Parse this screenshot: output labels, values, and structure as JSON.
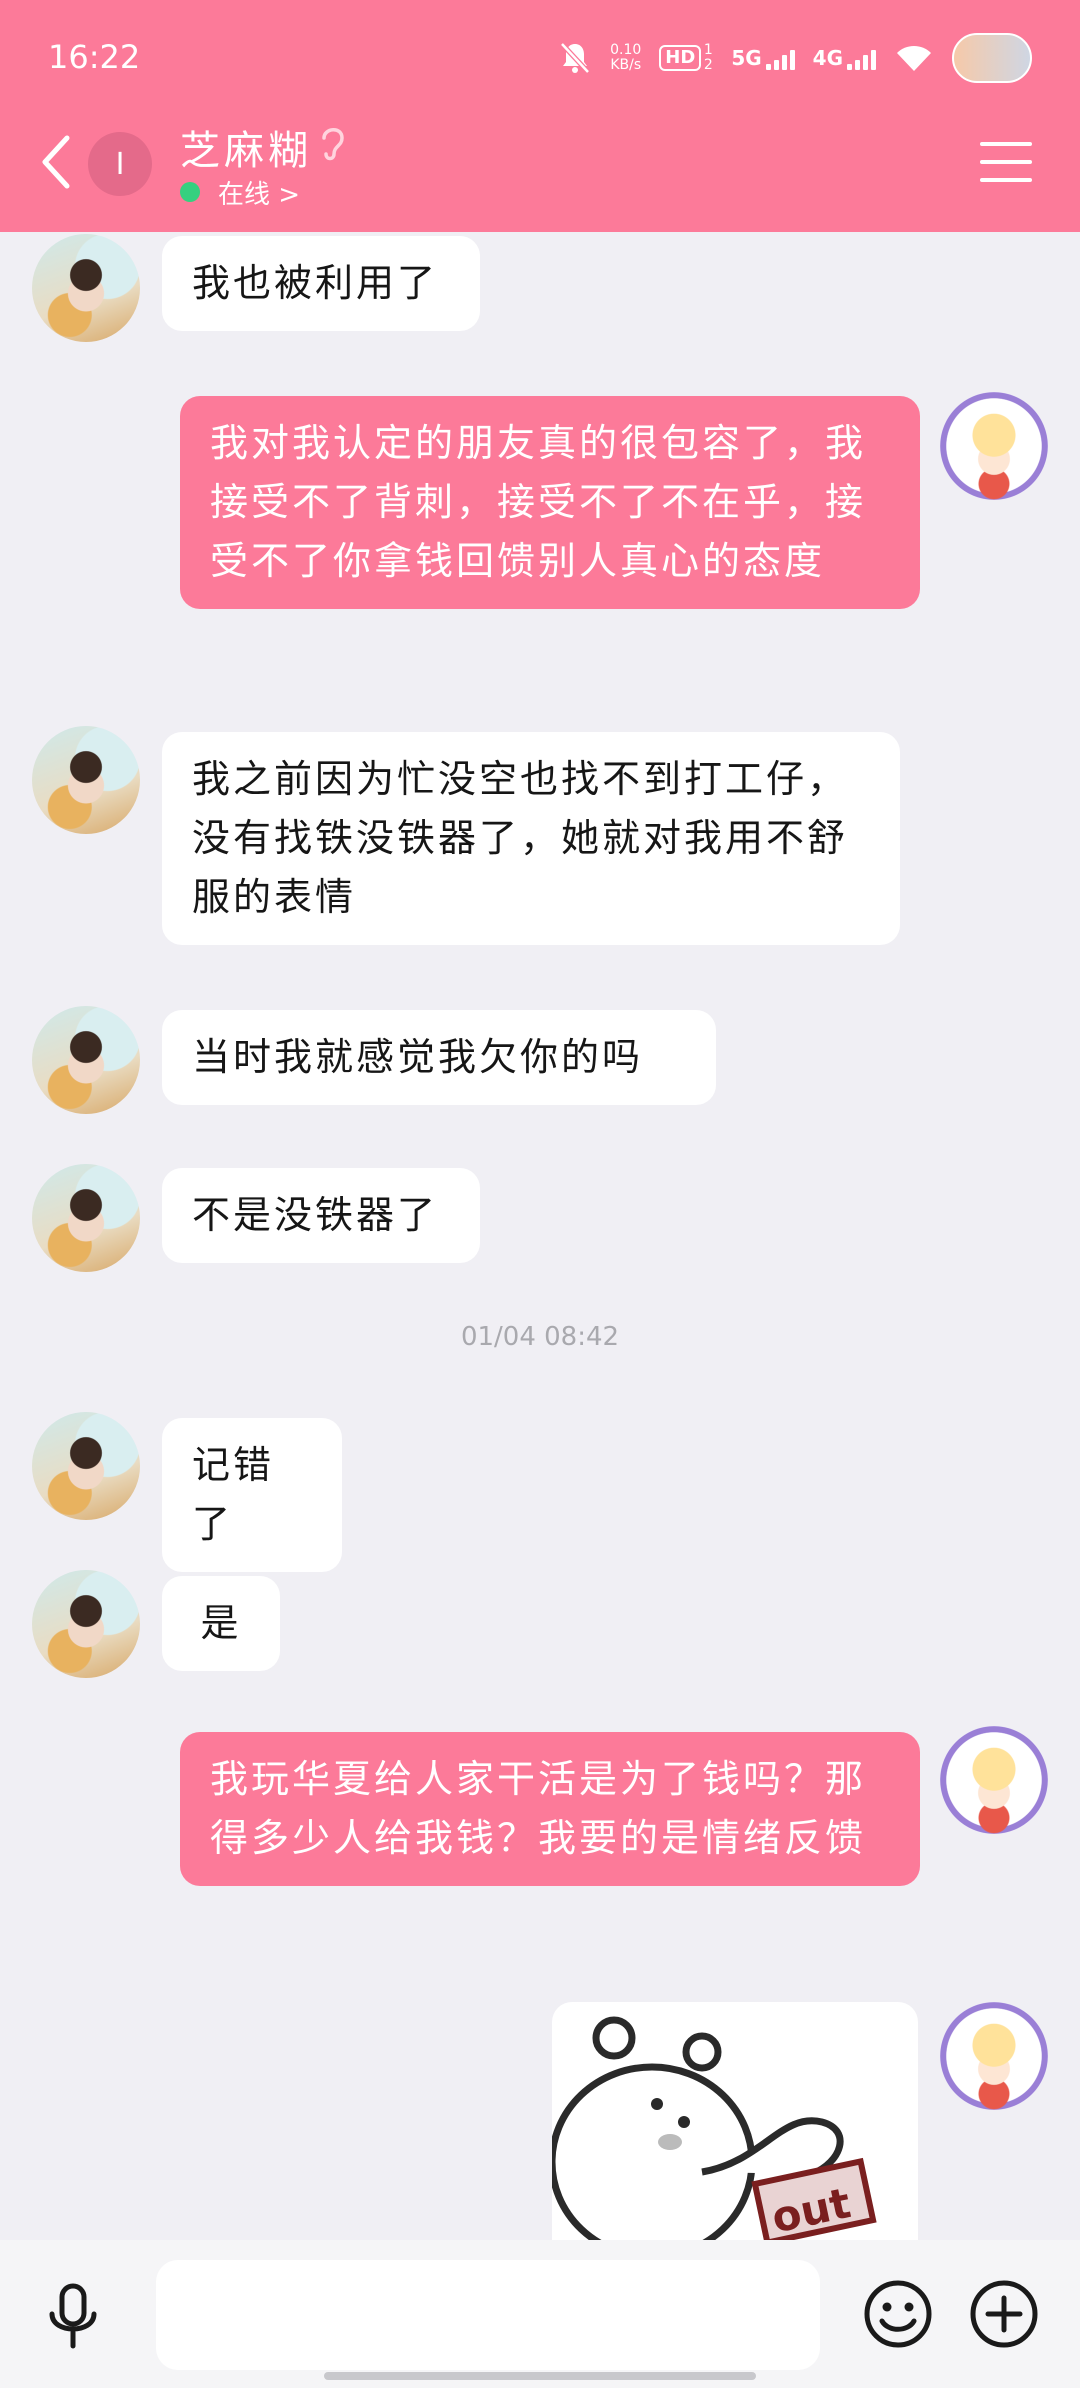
{
  "status_bar": {
    "time": "16:22",
    "net_speed_value": "0.10",
    "net_speed_unit": "KB/s",
    "hd_label": "HD",
    "hd_sub": "1 2",
    "sig1_label": "5G",
    "sig2_label": "4G"
  },
  "header": {
    "avatar_text": "I",
    "contact_name": "芝麻糊",
    "online_status": "在线 >",
    "online_color": "#35d07f",
    "accent_color": "#fc7a99"
  },
  "messages": [
    {
      "side": "left",
      "text": "我也被利用了"
    },
    {
      "side": "right",
      "text": "我对我认定的朋友真的很包容了，我接受不了背刺，接受不了不在乎，接受不了你拿钱回馈别人真心的态度"
    },
    {
      "side": "left",
      "text": "我之前因为忙没空也找不到打工仔，没有找铁没铁器了，她就对我用不舒服的表情"
    },
    {
      "side": "left",
      "text": "当时我就感觉我欠你的吗"
    },
    {
      "side": "left",
      "text": "不是没铁器了"
    },
    {
      "timestamp": "01/04 08:42"
    },
    {
      "side": "left",
      "text": "记错了"
    },
    {
      "side": "left",
      "text": "是"
    },
    {
      "side": "right",
      "text": "我玩华夏给人家干活是为了钱吗？那得多少人给我钱？我要的是情绪反馈"
    },
    {
      "side": "right",
      "sticker": "out"
    }
  ],
  "input": {
    "placeholder": ""
  }
}
